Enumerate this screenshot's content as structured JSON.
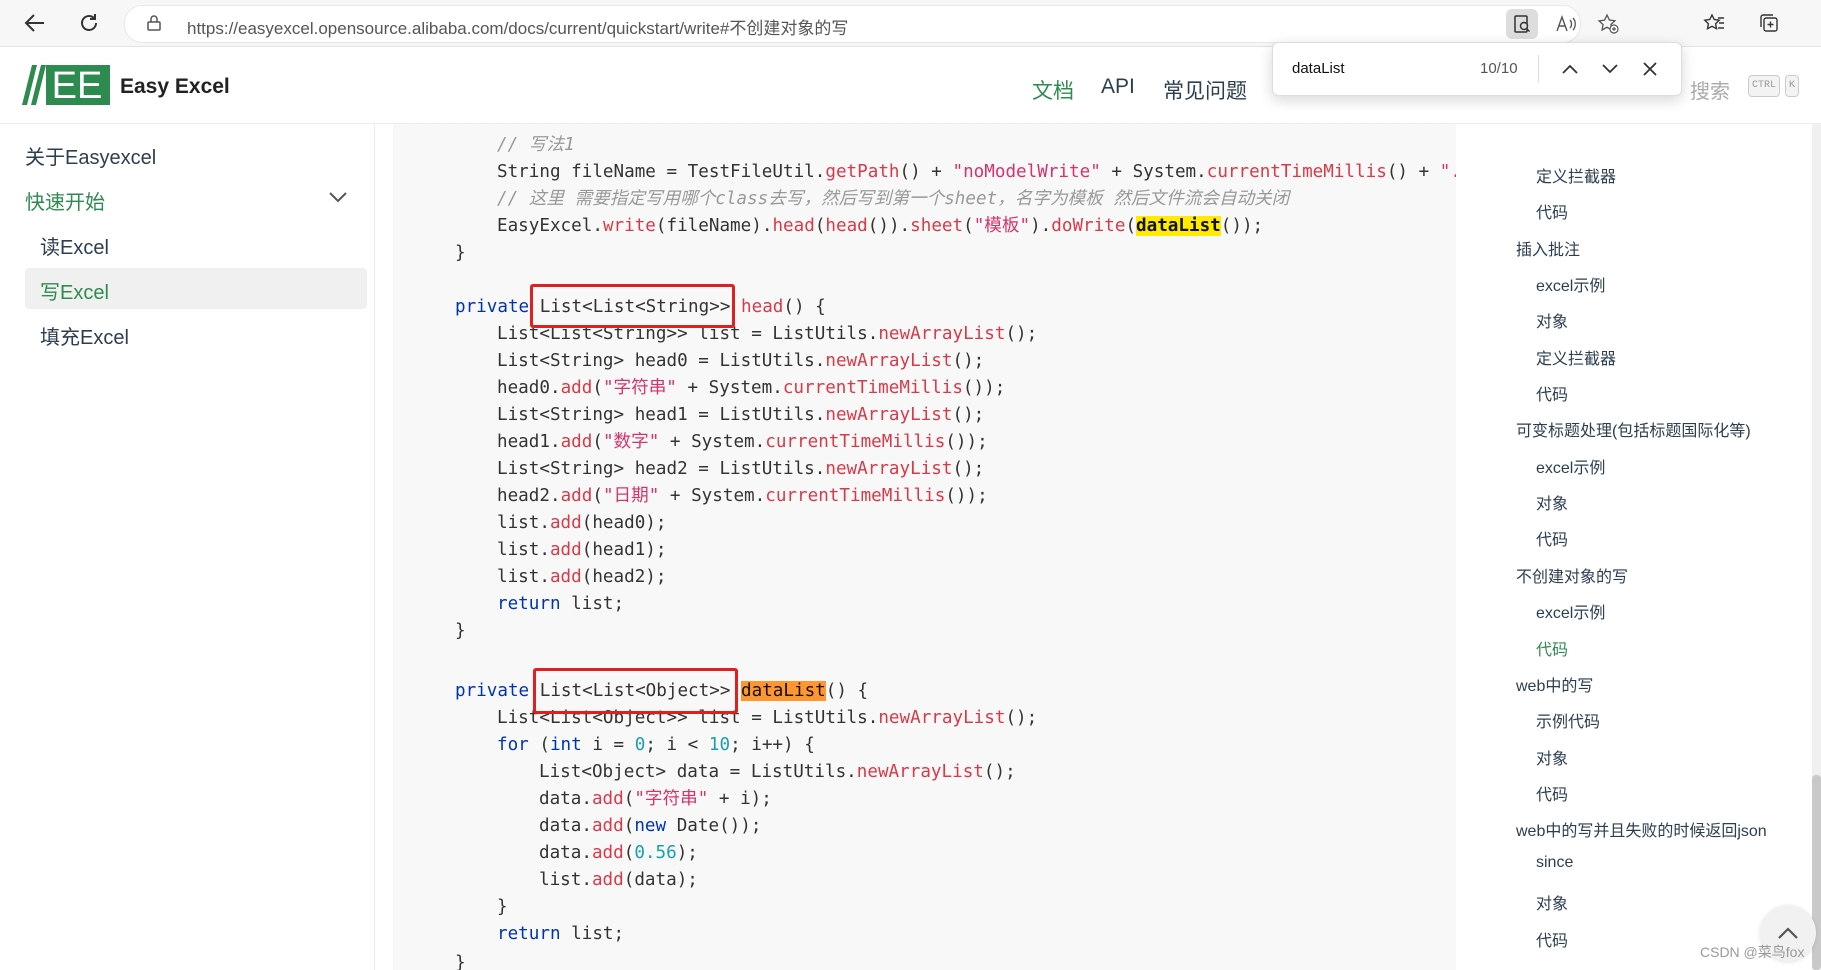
{
  "browser": {
    "url_base": "https://easyexcel.opensource.alibaba.com",
    "url_path": "/docs/current/quickstart/write#不创建对象的写",
    "icons": [
      "back-arrow-icon",
      "refresh-icon",
      "lock-icon",
      "find-in-page-icon",
      "read-aloud-icon",
      "add-favorite-icon",
      "favorites-icon",
      "collections-icon"
    ]
  },
  "find": {
    "query": "dataList",
    "count": "10/10",
    "prev_glyph": "⌃",
    "next_glyph": "⌄",
    "close_glyph": "✕"
  },
  "header": {
    "logo_text": "EE",
    "brand": "Easy Excel",
    "nav": [
      "文档",
      "API",
      "常见问题"
    ],
    "search_placeholder": "搜索",
    "kbd_ctrl": "CTRL",
    "kbd_k": "K"
  },
  "sidebar": {
    "items": [
      {
        "label": "关于Easyexcel"
      },
      {
        "label": "快速开始"
      },
      {
        "label": "读Excel"
      },
      {
        "label": "写Excel"
      },
      {
        "label": "填充Excel"
      }
    ]
  },
  "code": {
    "comment1": "// 写法1",
    "l1_a": "String fileName = TestFileUtil.",
    "l1_b": "getPath",
    "l1_c": "() + ",
    "l1_d": "\"noModelWrite\"",
    "l1_e": " + System.",
    "l1_f": "currentTimeMillis",
    "l1_g": "() + ",
    "l1_h": "\".x",
    "comment2": "// 这里 需要指定写用哪个class去写，然后写到第一个sheet，名字为模板 然后文件流会自动关闭",
    "l2_a": "EasyExcel.",
    "l2_b": "write",
    "l2_c": "(fileName).",
    "l2_d": "head",
    "l2_e": "(",
    "l2_f": "head",
    "l2_g": "()).",
    "l2_h": "sheet",
    "l2_i": "(",
    "l2_j": "\"模板\"",
    "l2_k": ").",
    "l2_l": "doWrite",
    "l2_m": "(",
    "l2_n": "dataList",
    "l2_o": "());",
    "brace": "}",
    "private": "private",
    "head_type": " List<List<String>> ",
    "head_name": "head",
    "sig_end": "() {",
    "h1": "List<List<String>> list = ListUtils.",
    "newArrayList": "newArrayList",
    "call_end": "();",
    "h2": "List<String> head0 = ListUtils.",
    "h3a": "head0.",
    "add": "add",
    "paren": "(",
    "s_zifuchuan": "\"字符串\"",
    "plus_sys": " + System.",
    "ctm": "currentTimeMillis",
    "dbl_end": "());",
    "h4": "List<String> head1 = ListUtils.",
    "h5a": "head1.",
    "s_shuzi": "\"数字\"",
    "h6": "List<String> head2 = ListUtils.",
    "h7a": "head2.",
    "s_riqi": "\"日期\"",
    "list_dot": "list.",
    "arg_head0": "(head0);",
    "arg_head1": "(head1);",
    "arg_head2": "(head2);",
    "return": "return",
    "ret_list": " list;",
    "data_type": " List<List<Object>> ",
    "data_name": "dataList",
    "d1": "List<List<Object>> list = ListUtils.",
    "for": "for",
    "for_a": " (",
    "int": "int",
    "for_b": " i = ",
    "zero": "0",
    "for_c": "; i < ",
    "ten": "10",
    "for_d": "; i++) {",
    "d2": "List<Object> data = ListUtils.",
    "data_dot": "data.",
    "plus_i": " + i);",
    "new": "new",
    "date_end": " Date());",
    "num056": "0.56",
    "close_paren": ");",
    "arg_data": "(data);"
  },
  "toc": {
    "items": [
      {
        "label": "定义拦截器"
      },
      {
        "label": "代码"
      },
      {
        "label": "插入批注"
      },
      {
        "label": "excel示例"
      },
      {
        "label": "对象"
      },
      {
        "label": "定义拦截器"
      },
      {
        "label": "代码"
      },
      {
        "label": "可变标题处理(包括标题国际化等)"
      },
      {
        "label": "excel示例"
      },
      {
        "label": "对象"
      },
      {
        "label": "代码"
      },
      {
        "label": "不创建对象的写"
      },
      {
        "label": "excel示例"
      },
      {
        "label": "代码"
      },
      {
        "label": "web中的写"
      },
      {
        "label": "示例代码"
      },
      {
        "label": "对象"
      },
      {
        "label": "代码"
      },
      {
        "label": "web中的写并且失败的时候返回json"
      },
      {
        "label": "since"
      },
      {
        "label": "对象"
      },
      {
        "label": "代码"
      }
    ]
  },
  "watermark": "CSDN @菜鸟fox",
  "colors": {
    "accent_green": "#2e8b4f",
    "annotation_red": "#e02020",
    "find_highlight": "#ffeb00",
    "find_current": "#ff9632"
  }
}
